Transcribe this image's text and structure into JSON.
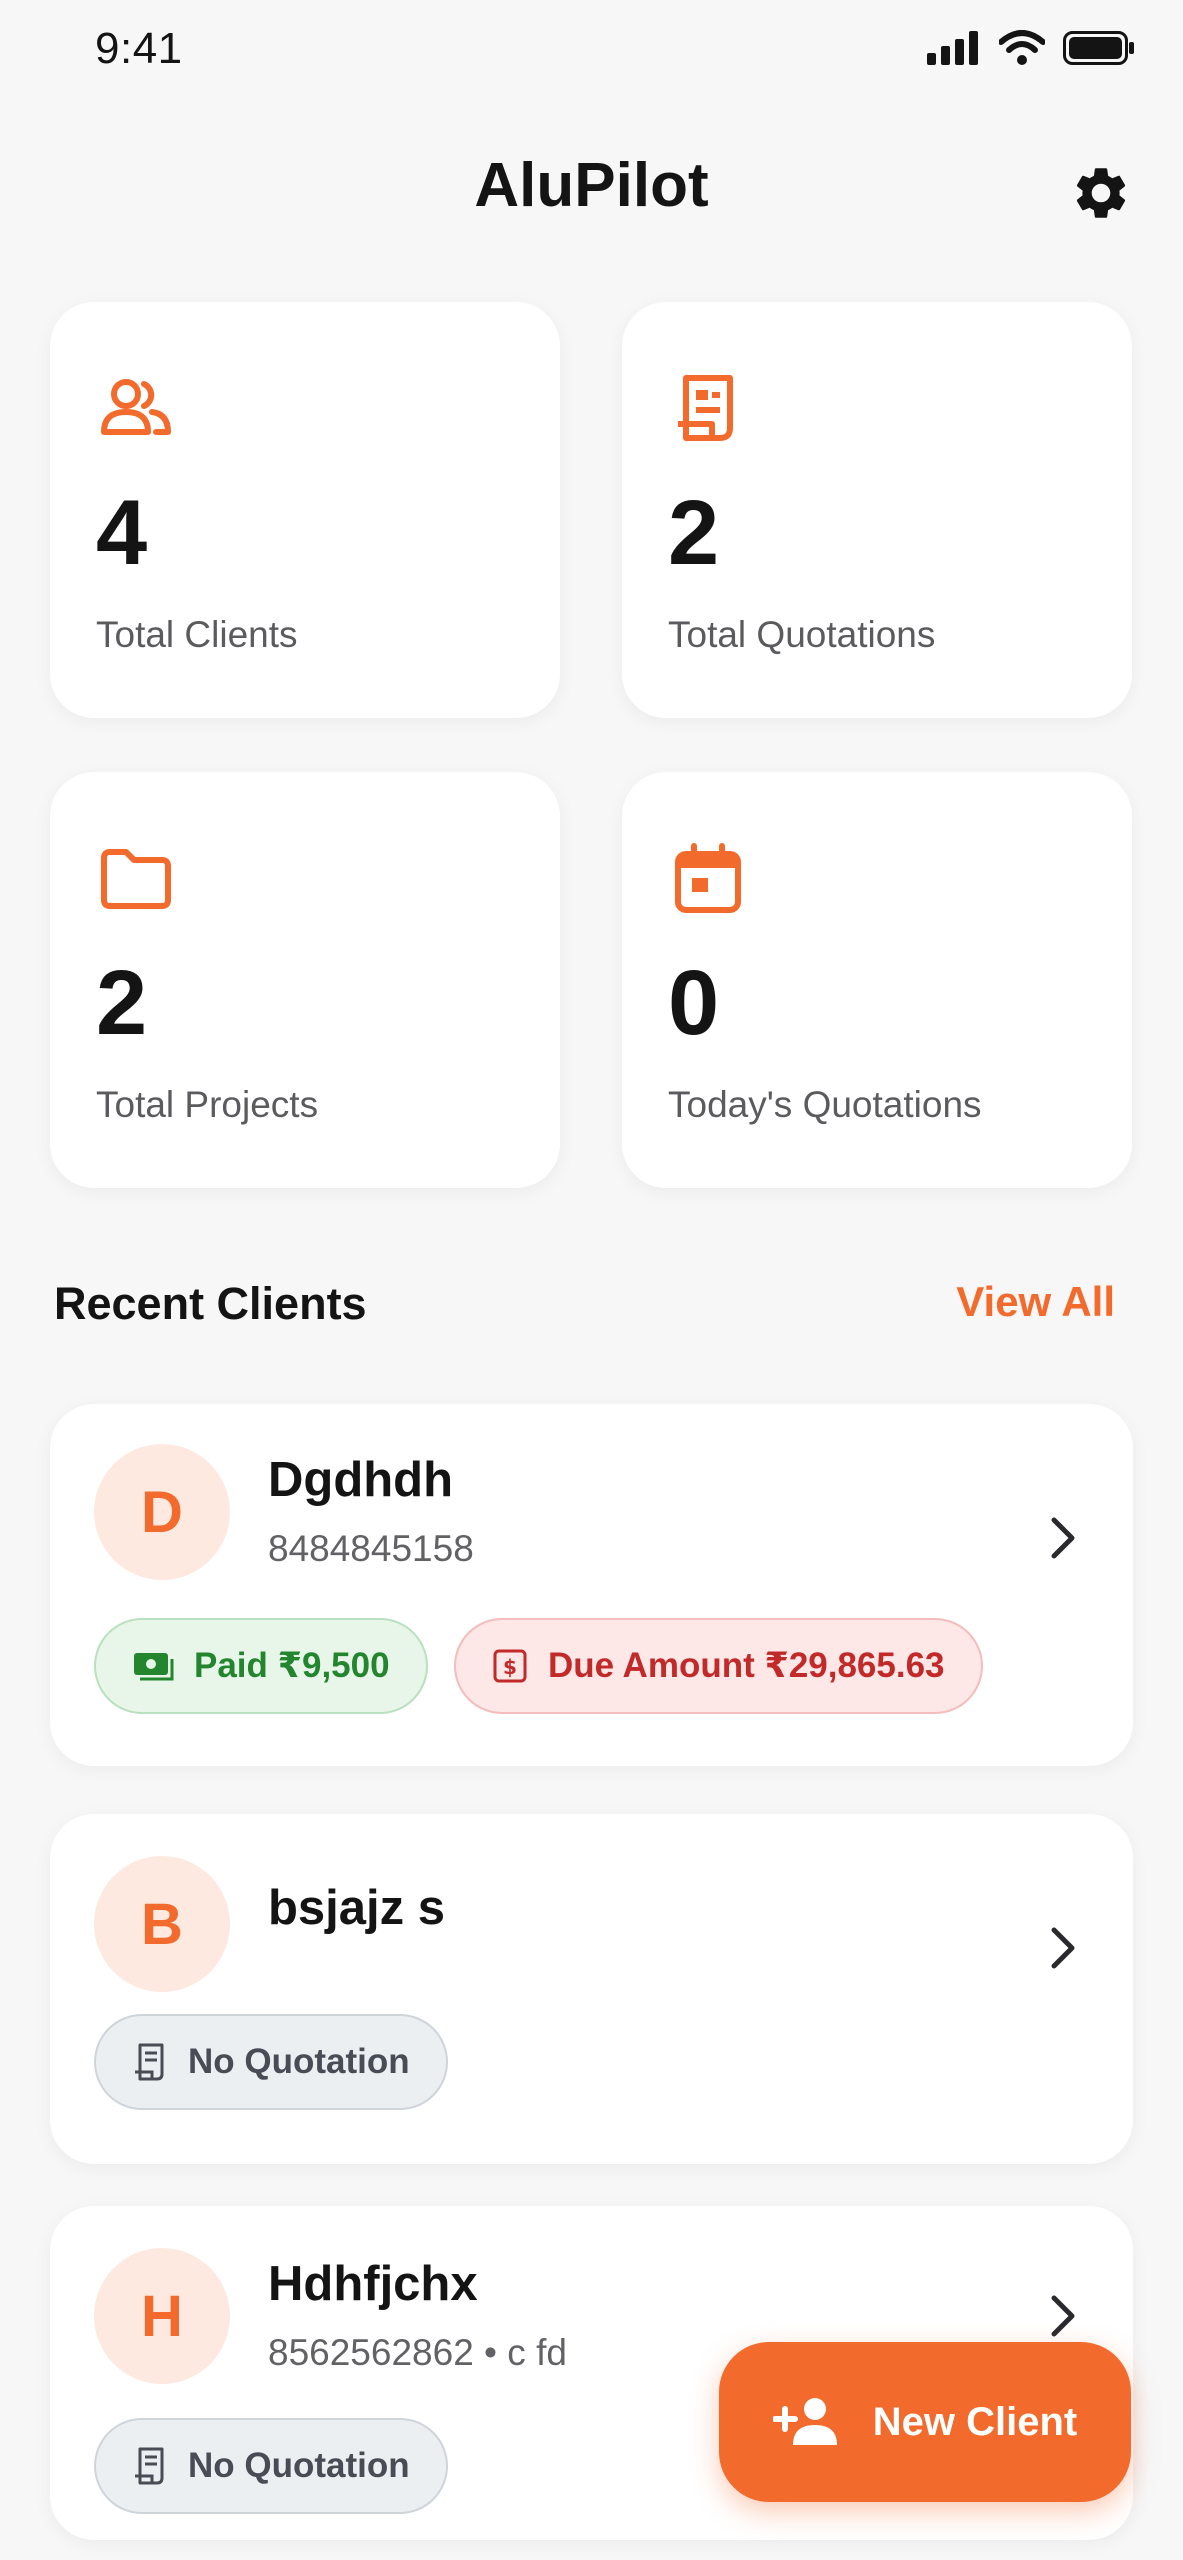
{
  "status_bar": {
    "time": "9:41"
  },
  "header": {
    "title": "AluPilot"
  },
  "stats": [
    {
      "icon": "users-icon",
      "value": "4",
      "label": "Total Clients"
    },
    {
      "icon": "quotation-icon",
      "value": "2",
      "label": "Total Quotations"
    },
    {
      "icon": "folder-icon",
      "value": "2",
      "label": "Total Projects"
    },
    {
      "icon": "calendar-icon",
      "value": "0",
      "label": "Today's Quotations"
    }
  ],
  "recent_clients": {
    "title": "Recent Clients",
    "view_all": "View All",
    "clients": [
      {
        "initial": "D",
        "name": "Dgdhdh",
        "subtitle": "8484845158",
        "paid": "Paid ₹9,500",
        "due": "Due Amount ₹29,865.63"
      },
      {
        "initial": "B",
        "name": "bsjajz s",
        "status": "No Quotation"
      },
      {
        "initial": "H",
        "name": "Hdhfjchx",
        "subtitle": "8562562862 • c fd",
        "status": "No Quotation"
      }
    ]
  },
  "fab": {
    "label": "New Client"
  },
  "colors": {
    "accent": "#f26a2c",
    "paid": "#23862f",
    "due": "#c22a2a",
    "neutral": "#474c55",
    "background": "#f7f7f8"
  }
}
